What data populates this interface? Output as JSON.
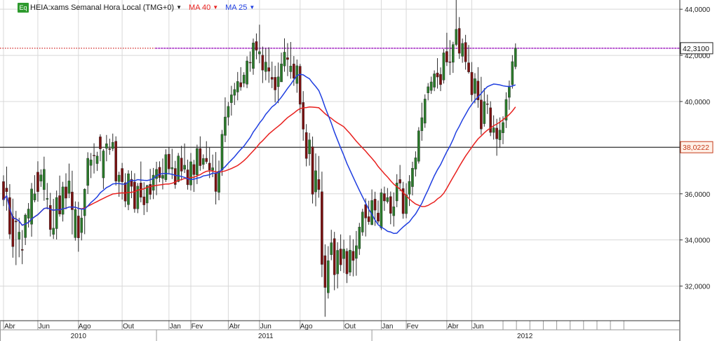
{
  "legend": {
    "badge": "Eq",
    "instrument": "HEIA:xams Semanal Hora Local (TMG+0)",
    "ma40": "MA 40",
    "ma25": "MA 25"
  },
  "colors": {
    "up_candle": "#2a7a2a",
    "down_candle": "#7a1010",
    "ma40": "#e8201e",
    "ma25": "#1f3ee0",
    "price_line": "#a020c0",
    "price_line_left": "#d02020",
    "grid": "#d8d8d8"
  },
  "chart_data": {
    "type": "candlestick",
    "ylim": [
      30.5,
      44.4
    ],
    "y_ticks": [
      "44,0000",
      "42,0000",
      "40,0000",
      "38,0000",
      "36,0000",
      "34,0000",
      "32,0000"
    ],
    "y_tick_values": [
      44,
      42,
      40,
      38,
      36,
      34,
      32
    ],
    "price_labels": {
      "current": {
        "text": "42,3100",
        "value": 42.31
      },
      "horizontal": {
        "text": "38,0222",
        "value": 38.02
      }
    },
    "x_month_labels": [
      "Abr",
      "Jun",
      "Ago",
      "Out",
      "Jan",
      "Fev",
      "Abr",
      "Jun",
      "Ago",
      "Out",
      "Jan",
      "Fev",
      "Abr",
      "Jun"
    ],
    "x_month_label_weeks": [
      2,
      13,
      26,
      40,
      55,
      62,
      74,
      84,
      97,
      111,
      123,
      131,
      144,
      152
    ],
    "x_year_labels": [
      "2010",
      "2011",
      "2012"
    ],
    "x_year_label_weeks": [
      24,
      84,
      167
    ],
    "x_year_boundary_weeks": [
      49,
      118
    ],
    "weeks_total": 216,
    "ohlc": [
      [
        36.53,
        36.8,
        35.47,
        35.74
      ],
      [
        36.25,
        37.18,
        35.27,
        36.09
      ],
      [
        35.84,
        36.42,
        34.04,
        34.25
      ],
      [
        35.02,
        35.79,
        33.23,
        33.71
      ],
      [
        34.82,
        35.26,
        32.91,
        34.78
      ],
      [
        34.03,
        34.96,
        33.25,
        34.34
      ],
      [
        33.59,
        34.43,
        32.95,
        33.55
      ],
      [
        34.1,
        35.15,
        33.78,
        35.08
      ],
      [
        34.94,
        35.6,
        34.54,
        35.34
      ],
      [
        34.68,
        36.47,
        34.14,
        36.21
      ],
      [
        35.73,
        36.81,
        35.63,
        36.0
      ],
      [
        36.94,
        37.41,
        35.66,
        36.09
      ],
      [
        36.55,
        37.06,
        36.3,
        36.82
      ],
      [
        36.18,
        37.61,
        35.7,
        37.06
      ],
      [
        35.76,
        36.47,
        35.33,
        35.8
      ],
      [
        35.5,
        36.04,
        34.15,
        34.45
      ],
      [
        34.24,
        35.78,
        34.04,
        34.51
      ],
      [
        34.49,
        36.14,
        34.02,
        35.84
      ],
      [
        35.92,
        36.79,
        35.01,
        35.12
      ],
      [
        35.11,
        36.52,
        34.8,
        36.3
      ],
      [
        36.3,
        36.89,
        35.33,
        35.81
      ],
      [
        36.02,
        37.31,
        35.81,
        36.56
      ],
      [
        36.08,
        37.0,
        34.24,
        35.31
      ],
      [
        34.1,
        35.67,
        33.97,
        35.32
      ],
      [
        35.04,
        35.65,
        33.49,
        34.09
      ],
      [
        34.32,
        35.35,
        33.98,
        34.95
      ],
      [
        35.05,
        36.24,
        34.25,
        36.2
      ],
      [
        36.36,
        37.8,
        35.99,
        37.54
      ],
      [
        37.23,
        37.77,
        36.68,
        37.47
      ],
      [
        37.67,
        38.19,
        36.88,
        37.64
      ],
      [
        37.31,
        37.82,
        36.99,
        37.64
      ],
      [
        38.47,
        38.58,
        37.41,
        37.95
      ],
      [
        36.69,
        37.94,
        36.21,
        37.86
      ],
      [
        37.97,
        38.55,
        37.41,
        38.17
      ],
      [
        37.96,
        38.39,
        37.69,
        37.92
      ],
      [
        37.96,
        38.61,
        37.85,
        38.23
      ],
      [
        38.28,
        38.49,
        36.36,
        36.55
      ],
      [
        36.53,
        36.96,
        35.87,
        36.81
      ],
      [
        37.1,
        37.34,
        35.75,
        36.52
      ],
      [
        36.48,
        36.89,
        35.42,
        35.68
      ],
      [
        35.53,
        37.02,
        35.29,
        36.87
      ],
      [
        36.63,
        37.0,
        35.81,
        36.32
      ],
      [
        36.51,
        36.89,
        35.18,
        35.35
      ],
      [
        35.35,
        36.47,
        35.16,
        36.33
      ],
      [
        36.47,
        37.4,
        35.63,
        35.85
      ],
      [
        35.87,
        36.5,
        35.08,
        35.52
      ],
      [
        35.6,
        36.39,
        35.21,
        36.36
      ],
      [
        36.41,
        37.08,
        35.75,
        35.97
      ],
      [
        36.15,
        37.12,
        35.77,
        36.81
      ],
      [
        36.66,
        37.39,
        35.94,
        37.06
      ],
      [
        37.15,
        37.41,
        36.5,
        36.7
      ],
      [
        36.67,
        37.53,
        36.19,
        36.8
      ],
      [
        36.61,
        37.93,
        36.51,
        37.7
      ],
      [
        37.72,
        38.01,
        36.84,
        37.08
      ],
      [
        37.08,
        37.95,
        36.64,
        37.14
      ],
      [
        37.1,
        37.43,
        36.22,
        36.4
      ],
      [
        36.53,
        37.77,
        36.5,
        37.64
      ],
      [
        37.55,
        38.08,
        36.58,
        36.98
      ],
      [
        37.06,
        38.18,
        36.9,
        37.24
      ],
      [
        37.04,
        37.48,
        36.18,
        36.39
      ],
      [
        36.38,
        37.77,
        36.14,
        37.39
      ],
      [
        37.27,
        37.47,
        36.08,
        36.83
      ],
      [
        36.82,
        38.13,
        36.42,
        37.96
      ],
      [
        37.96,
        38.49,
        37.0,
        37.22
      ],
      [
        37.27,
        37.71,
        37.07,
        37.53
      ],
      [
        37.54,
        38.28,
        37.3,
        37.39
      ],
      [
        37.33,
        38.02,
        36.68,
        37.03
      ],
      [
        37.02,
        37.7,
        36.72,
        37.13
      ],
      [
        36.89,
        37.81,
        35.54,
        36.1
      ],
      [
        36.06,
        37.44,
        35.72,
        36.98
      ],
      [
        37.03,
        38.77,
        36.78,
        38.58
      ],
      [
        38.53,
        40.18,
        38.24,
        39.33
      ],
      [
        39.32,
        39.98,
        38.96,
        39.79
      ],
      [
        39.95,
        40.68,
        39.39,
        40.29
      ],
      [
        40.27,
        40.81,
        39.85,
        40.52
      ],
      [
        40.41,
        41.28,
        40.05,
        40.87
      ],
      [
        40.82,
        41.49,
        40.47,
        40.63
      ],
      [
        40.79,
        41.27,
        40.62,
        41.15
      ],
      [
        40.75,
        41.96,
        40.58,
        41.76
      ],
      [
        41.7,
        42.17,
        41.29,
        41.68
      ],
      [
        41.43,
        42.73,
        41.16,
        42.54
      ],
      [
        42.6,
        42.95,
        41.83,
        42.22
      ],
      [
        42.06,
        43.33,
        41.66,
        42.16
      ],
      [
        42.01,
        42.38,
        40.8,
        41.36
      ],
      [
        41.3,
        42.32,
        40.92,
        41.71
      ],
      [
        41.47,
        42.35,
        40.81,
        41.31
      ],
      [
        41.05,
        41.73,
        40.58,
        40.96
      ],
      [
        41.05,
        41.55,
        39.96,
        40.5
      ],
      [
        40.64,
        41.69,
        39.93,
        41.07
      ],
      [
        40.85,
        42.12,
        40.85,
        41.63
      ],
      [
        41.54,
        42.74,
        41.29,
        42.14
      ],
      [
        41.9,
        42.53,
        41.1,
        41.82
      ],
      [
        41.29,
        42.58,
        40.99,
        41.54
      ],
      [
        41.63,
        41.97,
        40.68,
        41.01
      ],
      [
        40.78,
        41.82,
        40.38,
        41.55
      ],
      [
        41.53,
        41.63,
        39.5,
        39.88
      ],
      [
        39.96,
        40.45,
        38.3,
        38.8
      ],
      [
        38.66,
        39.02,
        37.19,
        37.53
      ],
      [
        37.73,
        38.64,
        37.22,
        38.34
      ],
      [
        38.04,
        38.48,
        35.58,
        35.98
      ],
      [
        36.08,
        37.75,
        35.46,
        37.0
      ],
      [
        36.62,
        37.64,
        35.83,
        36.18
      ],
      [
        36.09,
        36.96,
        32.39,
        32.94
      ],
      [
        33.32,
        33.81,
        30.67,
        31.94
      ],
      [
        31.71,
        33.73,
        31.46,
        33.1
      ],
      [
        33.36,
        34.44,
        33.12,
        33.88
      ],
      [
        34.06,
        34.35,
        31.82,
        32.49
      ],
      [
        32.53,
        33.9,
        31.9,
        33.55
      ],
      [
        33.61,
        34.24,
        32.65,
        32.92
      ],
      [
        33.19,
        34.01,
        32.57,
        33.6
      ],
      [
        33.51,
        33.64,
        32.13,
        32.53
      ],
      [
        32.6,
        34.2,
        32.44,
        33.56
      ],
      [
        33.51,
        34.03,
        32.42,
        33.11
      ],
      [
        33.2,
        34.39,
        32.45,
        33.75
      ],
      [
        33.62,
        34.74,
        33.35,
        34.56
      ],
      [
        34.34,
        35.35,
        34.18,
        35.21
      ],
      [
        35.53,
        35.8,
        34.15,
        34.95
      ],
      [
        35.01,
        35.7,
        34.66,
        34.79
      ],
      [
        34.66,
        36.19,
        34.64,
        35.71
      ],
      [
        35.77,
        36.09,
        34.61,
        35.29
      ],
      [
        35.17,
        35.71,
        34.71,
        34.81
      ],
      [
        34.52,
        36.22,
        34.43,
        36.05
      ],
      [
        36.01,
        36.31,
        35.26,
        35.69
      ],
      [
        35.66,
        36.25,
        35.58,
        35.84
      ],
      [
        35.88,
        36.1,
        34.68,
        35.15
      ],
      [
        35.05,
        36.06,
        34.58,
        35.44
      ],
      [
        35.69,
        36.85,
        35.42,
        36.47
      ],
      [
        36.62,
        37.25,
        36.11,
        36.46
      ],
      [
        36.23,
        36.52,
        34.92,
        35.14
      ],
      [
        35.14,
        36.46,
        34.94,
        35.96
      ],
      [
        35.98,
        36.81,
        35.47,
        36.54
      ],
      [
        36.31,
        37.39,
        35.93,
        37.11
      ],
      [
        37.07,
        37.84,
        36.75,
        37.56
      ],
      [
        37.41,
        38.89,
        37.31,
        38.73
      ],
      [
        38.73,
        39.95,
        38.3,
        39.3
      ],
      [
        39.06,
        40.31,
        38.86,
        40.11
      ],
      [
        40.37,
        40.8,
        40.05,
        40.64
      ],
      [
        40.48,
        41.08,
        40.33,
        40.85
      ],
      [
        40.62,
        41.35,
        40.45,
        41.2
      ],
      [
        41.24,
        41.88,
        40.56,
        41.06
      ],
      [
        41.18,
        41.48,
        40.45,
        40.73
      ],
      [
        40.93,
        42.28,
        40.78,
        42.11
      ],
      [
        42.17,
        42.98,
        41.54,
        41.71
      ],
      [
        41.72,
        42.66,
        41.15,
        41.7
      ],
      [
        41.7,
        42.59,
        41.24,
        42.47
      ],
      [
        42.47,
        44.69,
        42.39,
        43.13
      ],
      [
        43.17,
        43.66,
        41.85,
        42.09
      ],
      [
        41.96,
        42.73,
        41.68,
        42.52
      ],
      [
        42.56,
        42.89,
        41.38,
        41.72
      ],
      [
        41.68,
        42.45,
        41.21,
        41.28
      ],
      [
        41.27,
        41.71,
        39.99,
        40.29
      ],
      [
        40.35,
        41.23,
        39.92,
        40.99
      ],
      [
        40.89,
        41.49,
        39.73,
        40.07
      ],
      [
        40.07,
        41.07,
        38.56,
        38.81
      ],
      [
        39.04,
        40.58,
        38.91,
        40.0
      ],
      [
        39.9,
        40.3,
        39.46,
        39.89
      ],
      [
        39.73,
        40.01,
        38.5,
        38.66
      ],
      [
        38.66,
        39.4,
        38.35,
        38.86
      ],
      [
        38.85,
        39.25,
        37.65,
        38.38
      ],
      [
        38.34,
        39.31,
        37.99,
        38.76
      ],
      [
        38.64,
        39.36,
        38.15,
        39.09
      ],
      [
        39.19,
        40.4,
        38.85,
        40.09
      ],
      [
        40.18,
        40.91,
        39.64,
        40.64
      ],
      [
        40.73,
        42.01,
        40.56,
        41.73
      ],
      [
        41.51,
        42.52,
        41.4,
        42.31
      ]
    ]
  }
}
